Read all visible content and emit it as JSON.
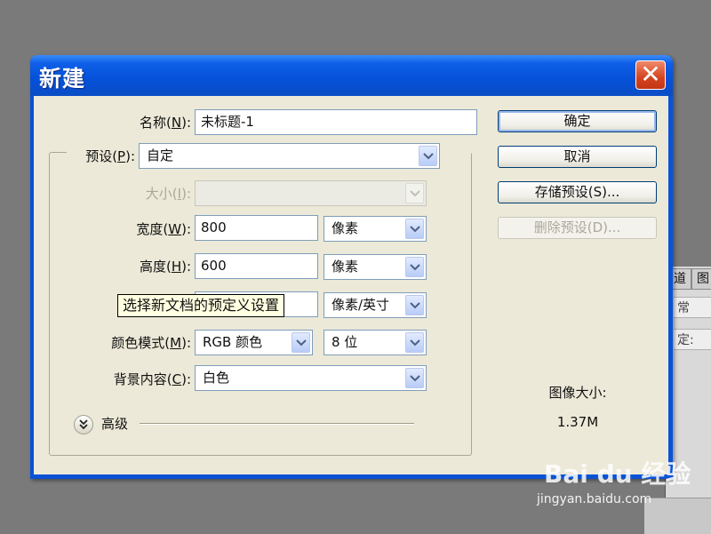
{
  "dialog": {
    "title": "新建",
    "close_glyph": "✕"
  },
  "fields": {
    "name": {
      "label": "名称(",
      "key": "N",
      "suffix": "):",
      "value": "未标题-1"
    },
    "preset": {
      "label": "预设(",
      "key": "P",
      "suffix": "):",
      "value": "自定"
    },
    "size": {
      "label": "大小(",
      "key": "I",
      "suffix": "):",
      "value": ""
    },
    "width": {
      "label": "宽度(",
      "key": "W",
      "suffix": "):",
      "value": "800",
      "unit": "像素"
    },
    "height": {
      "label": "高度(",
      "key": "H",
      "suffix": "):",
      "value": "600",
      "unit": "像素"
    },
    "resolution": {
      "unit": "像素/英寸"
    },
    "color_mode": {
      "label": "颜色模式(",
      "key": "M",
      "suffix": "):",
      "value": "RGB 颜色",
      "bits": "8 位"
    },
    "background": {
      "label": "背景内容(",
      "key": "C",
      "suffix": "):",
      "value": "白色"
    },
    "advanced": {
      "label": "高级"
    }
  },
  "tooltip": "选择新文档的预定义设置",
  "buttons": {
    "ok": "确定",
    "cancel": "取消",
    "save_preset": "存储预设(S)...",
    "delete_preset": "删除预设(D)..."
  },
  "image_size": {
    "label": "图像大小:",
    "value": "1.37M"
  },
  "background_app": {
    "tab1": "道",
    "tab2": "图",
    "row1": "常",
    "row2": "定:"
  },
  "watermark": {
    "brand": "Bai du 经验",
    "url": "jingyan.baidu.com"
  },
  "colors": {
    "title_bar": "#0a52d6",
    "dialog_bg": "#ece9d8",
    "close_button": "#d4431f",
    "tooltip_bg": "#ffffe1"
  }
}
